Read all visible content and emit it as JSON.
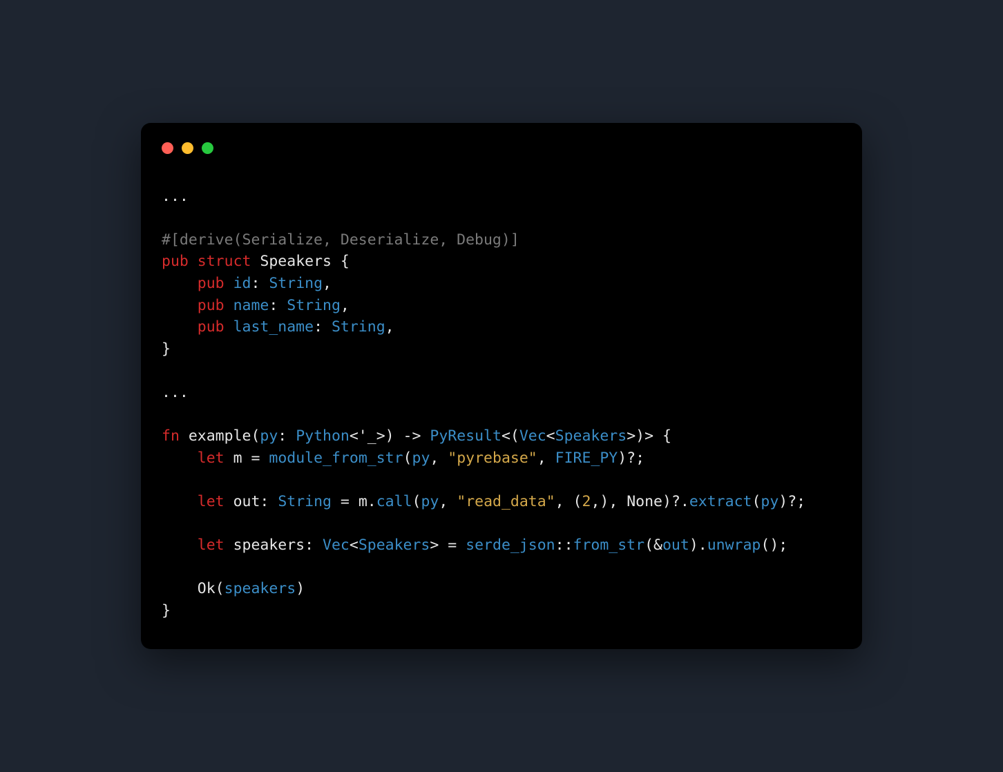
{
  "colors": {
    "background": "#1e2530",
    "window": "#000000",
    "default": "#e6e6e6",
    "keyword": "#d62b2b",
    "type": "#3b8ec8",
    "string": "#d4a84a",
    "comment": "#7a7a7a",
    "dot_red": "#ff5f56",
    "dot_yellow": "#ffbd2e",
    "dot_green": "#27c93f"
  },
  "code": {
    "l1": "...",
    "l2": "",
    "l3_attr": "#[derive(Serialize, Deserialize, Debug)]",
    "l4_pub": "pub",
    "l4_struct": "struct",
    "l4_name": "Speakers",
    "l4_brace": " {",
    "l5_pub": "pub",
    "l5_field": "id",
    "l5_type": "String",
    "l6_pub": "pub",
    "l6_field": "name",
    "l6_type": "String",
    "l7_pub": "pub",
    "l7_field": "last_name",
    "l7_type": "String",
    "l8": "}",
    "l9": "",
    "l10": "...",
    "l11": "",
    "l12_fn": "fn",
    "l12_name": "example",
    "l12_py": "py",
    "l12_pytype": "Python",
    "l12_gen": "<'_>",
    "l12_arrow": " -> ",
    "l12_res": "PyResult",
    "l12_vec": "Vec",
    "l12_spk": "Speakers",
    "l13_let": "let",
    "l13_m": "m",
    "l13_fn": "module_from_str",
    "l13_py": "py",
    "l13_str": "\"pyrebase\"",
    "l13_const": "FIRE_PY",
    "l14": "",
    "l15_let": "let",
    "l15_out": "out",
    "l15_type": "String",
    "l15_m": "m",
    "l15_call": "call",
    "l15_py": "py",
    "l15_str": "\"read_data\"",
    "l15_num": "2",
    "l15_none": "None",
    "l15_extract": "extract",
    "l15_py2": "py",
    "l16": "",
    "l17_let": "let",
    "l17_var": "speakers",
    "l17_vec": "Vec",
    "l17_spk": "Speakers",
    "l17_sj": "serde_json",
    "l17_fs": "from_str",
    "l17_out": "out",
    "l17_unwrap": "unwrap",
    "l18": "",
    "l19_ok": "Ok",
    "l19_spk": "speakers",
    "l20": "}"
  }
}
